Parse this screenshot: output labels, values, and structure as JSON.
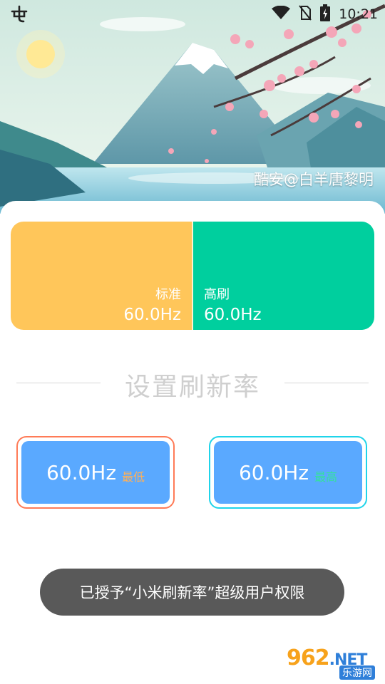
{
  "status_bar": {
    "time": "10:21",
    "icons": [
      "wifi-icon",
      "no-sim-icon",
      "battery-charging-icon"
    ]
  },
  "app_icon": "coolapk-logo-icon",
  "hero": {
    "credit": "酷安@白羊唐黎明"
  },
  "rate_card": {
    "standard": {
      "label": "标准",
      "value": "60.0Hz"
    },
    "high": {
      "label": "高刷",
      "value": "60.0Hz"
    },
    "colors": {
      "standard": "#ffc65a",
      "high": "#00cf9e"
    }
  },
  "section": {
    "title": "设置刷新率"
  },
  "buttons": {
    "min": {
      "value": "60.0Hz",
      "tag": "最低",
      "border": "#ff7b57"
    },
    "max": {
      "value": "60.0Hz",
      "tag": "最高",
      "border": "#1fd4ea"
    }
  },
  "toast": {
    "message": "已授予“小米刷新率”超级用户权限"
  },
  "watermark": {
    "big": "962",
    "net": ".NET",
    "small": "乐游网"
  }
}
